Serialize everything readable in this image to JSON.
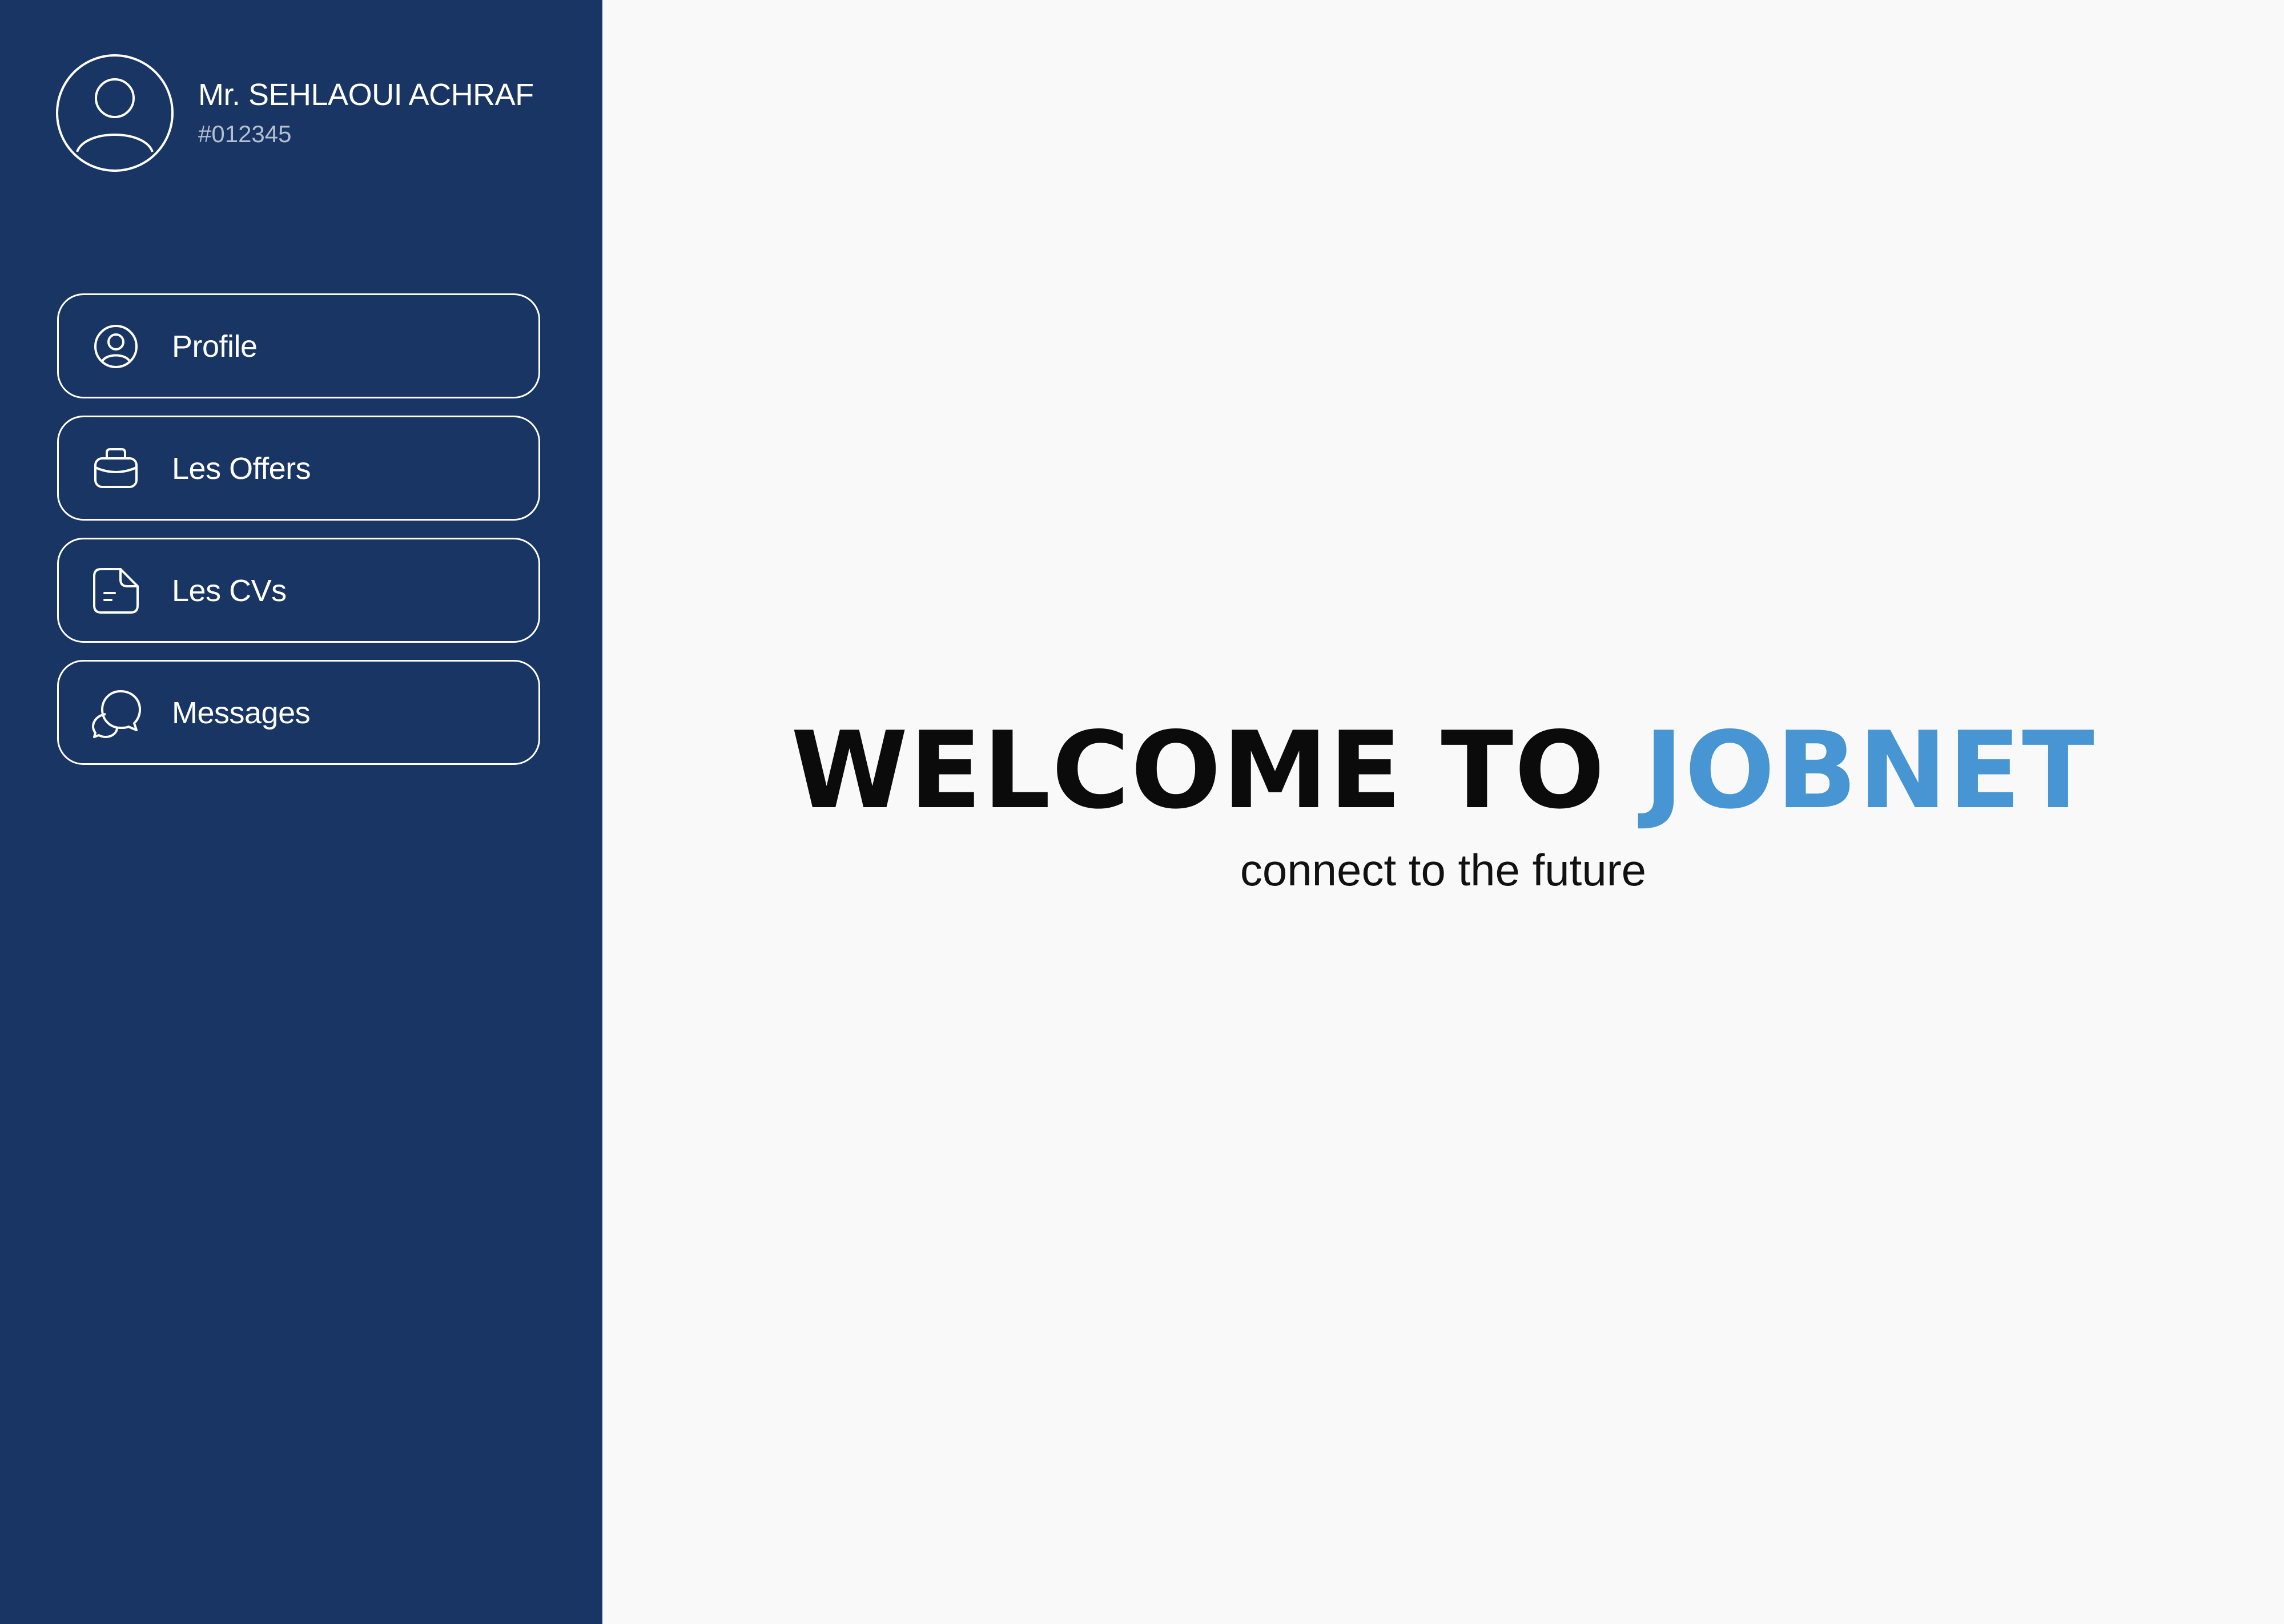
{
  "colors": {
    "sidebar_bg": "#193563",
    "main_bg": "#f9f9f9",
    "accent": "#4795d3",
    "text_dark": "#0b0b0b",
    "text_light": "#ffffff",
    "text_muted": "#b6bfd0"
  },
  "user": {
    "name": "Mr. SEHLAOUI ACHRAF",
    "id": "#012345",
    "avatar_icon": "user-circle-icon"
  },
  "sidebar": {
    "items": [
      {
        "label": "Profile",
        "icon": "user-circle-icon"
      },
      {
        "label": "Les Offers",
        "icon": "briefcase-icon"
      },
      {
        "label": "Les CVs",
        "icon": "document-icon"
      },
      {
        "label": "Messages",
        "icon": "chat-bubbles-icon"
      }
    ]
  },
  "main": {
    "welcome_prefix": "WELCOME TO",
    "brand": "JOBNET",
    "tagline": "connect to the future"
  }
}
